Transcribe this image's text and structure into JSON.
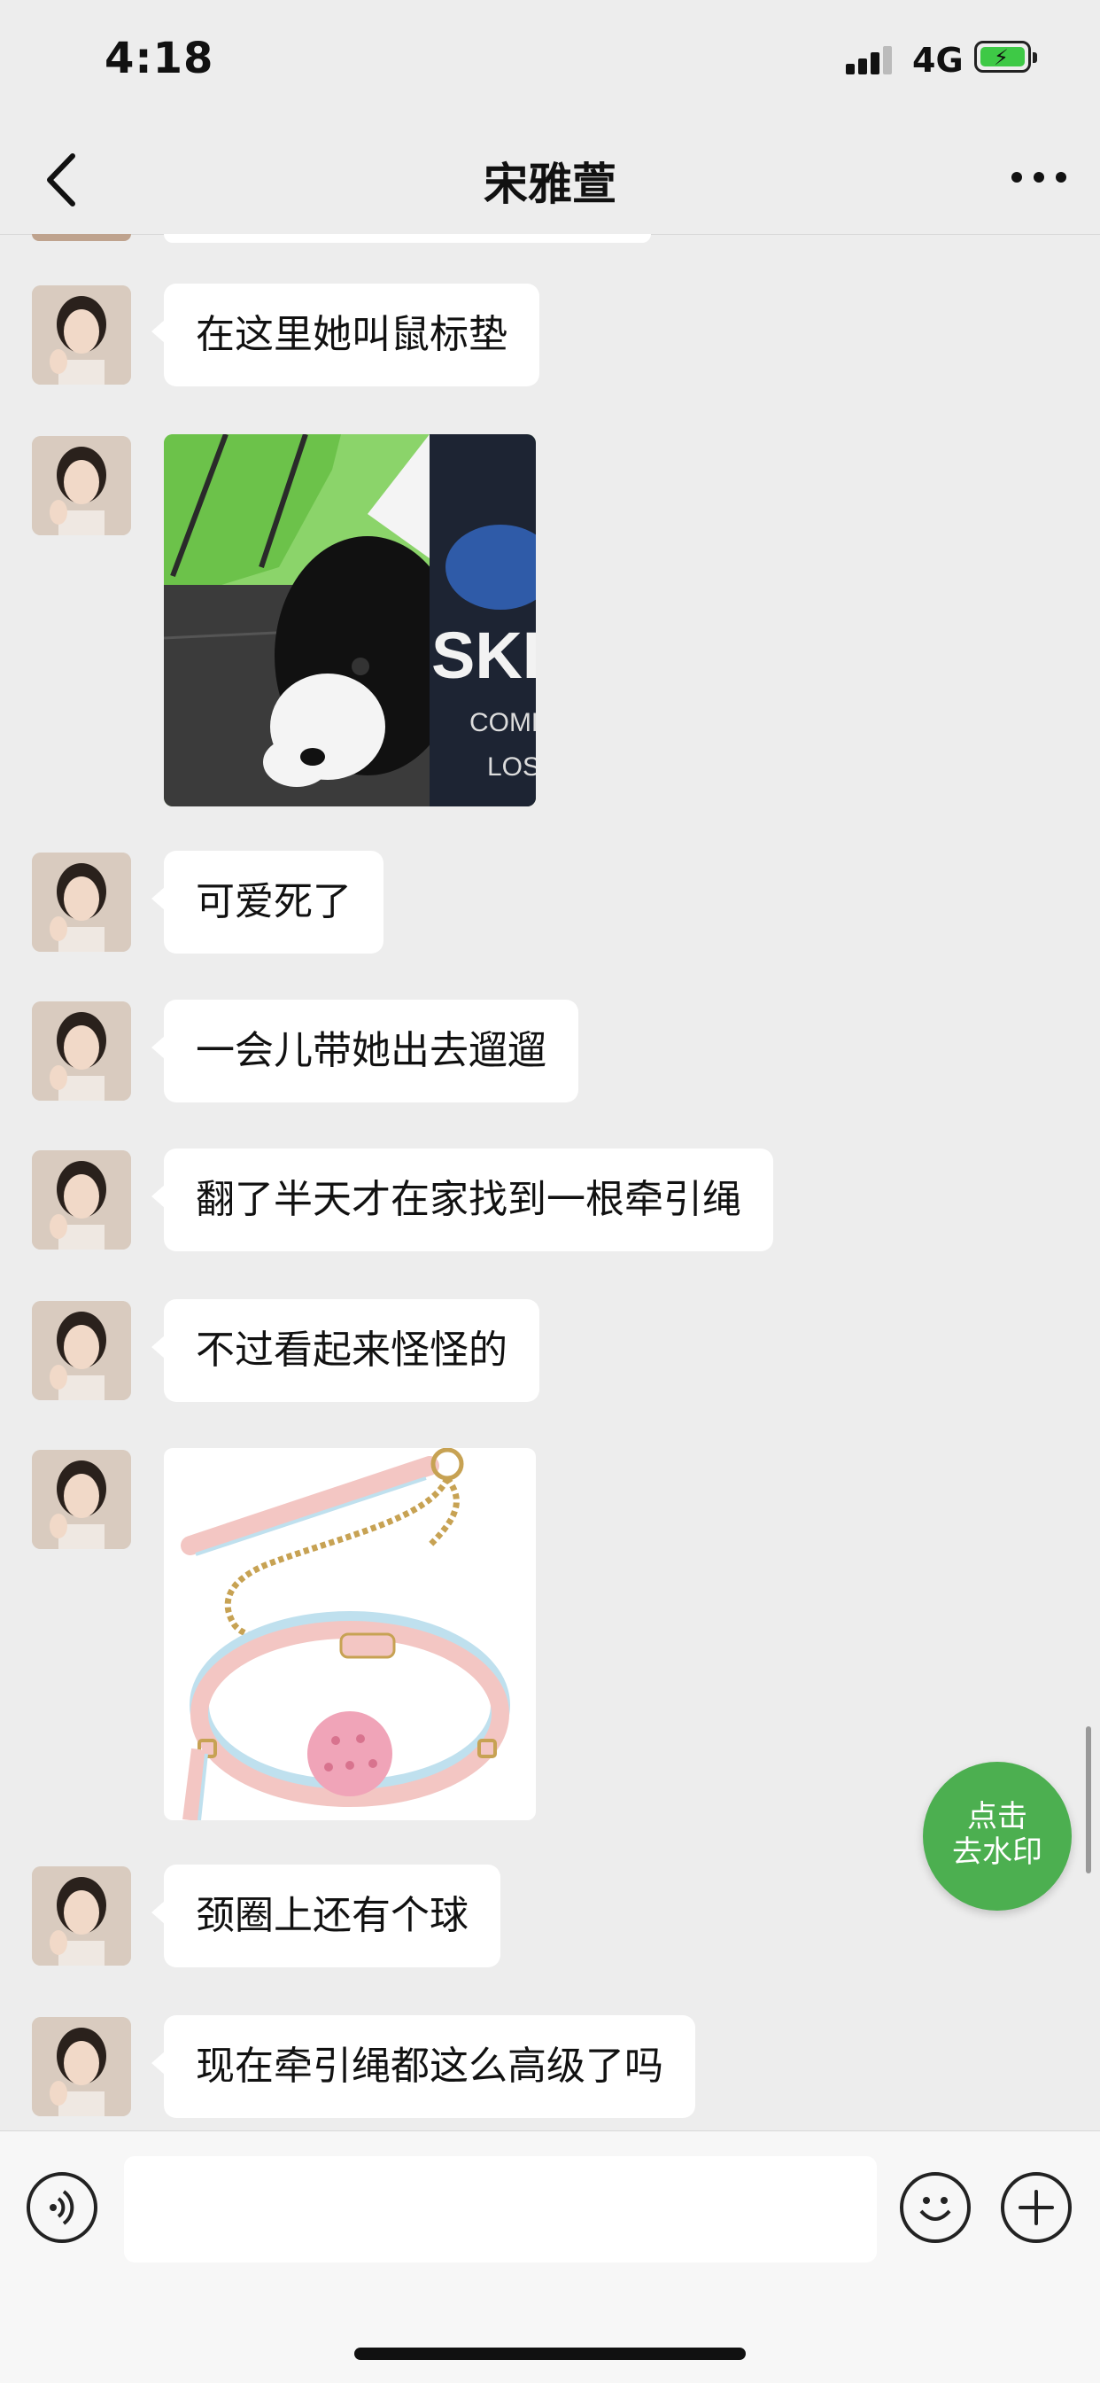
{
  "status_bar": {
    "time": "4:18",
    "network": "4G",
    "battery_charging": true
  },
  "nav": {
    "title": "宋雅萱",
    "back_icon": "chevron-left-icon",
    "more_icon": "ellipsis-icon"
  },
  "messages": [
    {
      "type": "text",
      "text": "在这里她叫鼠标垫"
    },
    {
      "type": "image",
      "content": "puppy-photo"
    },
    {
      "type": "text",
      "text": "可爱死了"
    },
    {
      "type": "text",
      "text": "一会儿带她出去遛遛"
    },
    {
      "type": "text",
      "text": "翻了半天才在家找到一根牵引绳"
    },
    {
      "type": "text",
      "text": "不过看起来怪怪的"
    },
    {
      "type": "image",
      "content": "collar-leash-photo"
    },
    {
      "type": "text",
      "text": "颈圈上还有个球"
    },
    {
      "type": "text",
      "text": "现在牵引绳都这么高级了吗"
    }
  ],
  "image_text": {
    "shirt_brand": "SKEC",
    "shirt_line1": "COMF",
    "shirt_line2": "LOS"
  },
  "watermark_button": {
    "line1": "点击",
    "line2": "去水印"
  },
  "input_bar": {
    "voice_icon": "voice-icon",
    "emoji_icon": "emoji-icon",
    "plus_icon": "plus-icon"
  },
  "colors": {
    "background": "#EDEDED",
    "bubble": "#FFFFFF",
    "watermark_button": "#4CAF50",
    "battery": "#3EC946"
  }
}
